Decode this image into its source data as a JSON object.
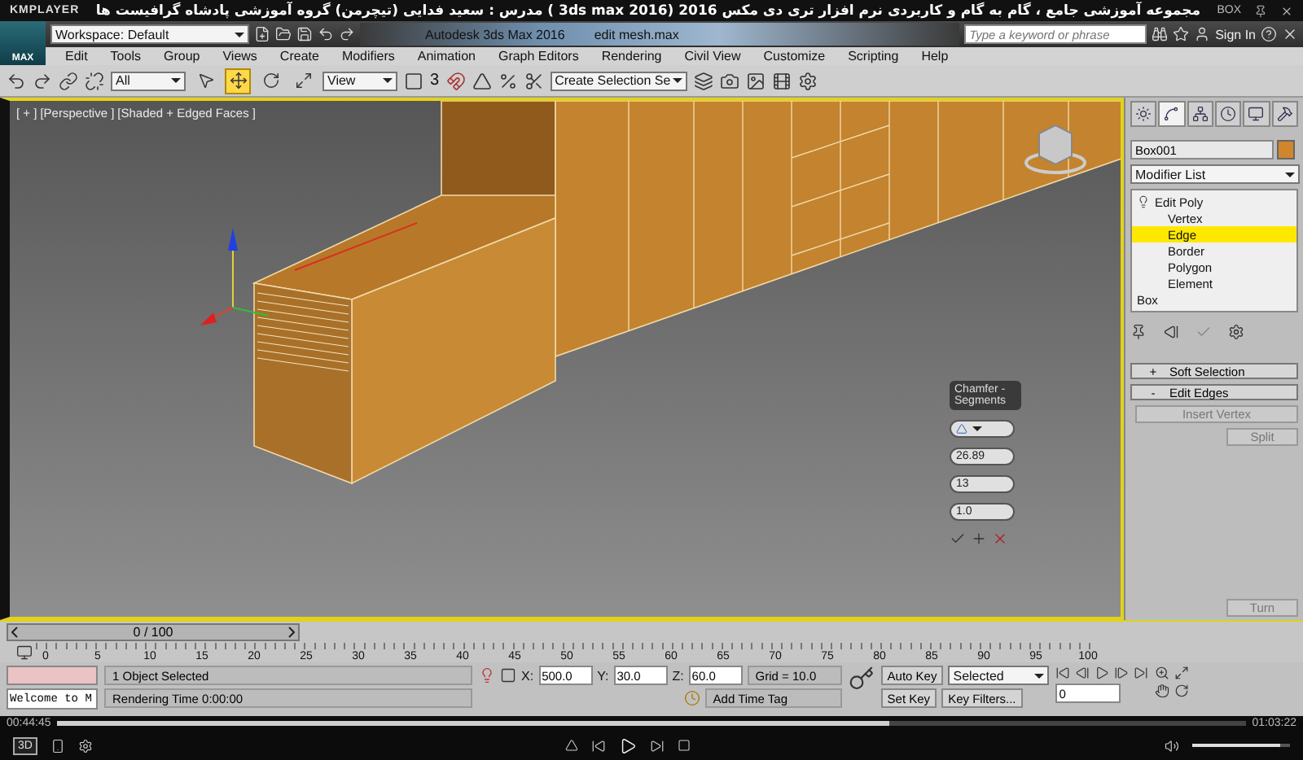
{
  "player": {
    "brand": "KMPLAYER",
    "title": "مجموعه آموزشی جامع ، گام به گام و کاربردی نرم افزار تری دی مکس 2016 (3ds max 2016 )  مدرس : سعید فدایی (تیچرمن) گروه آموزشی پادشاه گرافیست ها",
    "corner": "BOX",
    "elapsed": "00:44:45",
    "total": "01:03:22",
    "progress": {
      "level": 0.7
    },
    "volume": {
      "level": 0.9
    },
    "mode": "3D"
  },
  "app": {
    "logo": "MAX",
    "workspace": "Workspace: Default",
    "title": "Autodesk 3ds Max 2016",
    "file": "edit mesh.max",
    "search": {
      "placeholder": "Type a keyword or phrase"
    },
    "sign_in": "Sign In"
  },
  "menu": [
    "Edit",
    "Tools",
    "Group",
    "Views",
    "Create",
    "Modifiers",
    "Animation",
    "Graph Editors",
    "Rendering",
    "Civil View",
    "Customize",
    "Scripting",
    "Help"
  ],
  "toolbar": {
    "filter": "All",
    "coord": "View",
    "snap": "3",
    "selection_set": "Create Selection Se",
    "tools": [
      {
        "kind": "select",
        "selected": false
      },
      {
        "kind": "move",
        "selected": true
      },
      {
        "kind": "rotate",
        "selected": false
      },
      {
        "kind": "scale",
        "selected": false
      }
    ]
  },
  "viewport": {
    "labels": [
      "[ + ]",
      "[Perspective ]",
      "[Shaded + Edged Faces ]"
    ]
  },
  "caddy": {
    "title": "Chamfer -Segments",
    "fields": [
      "26.89",
      "13",
      "1.0"
    ]
  },
  "command_panel": {
    "tabs": [
      {
        "kind": "create",
        "selected": false
      },
      {
        "kind": "modify",
        "selected": true
      },
      {
        "kind": "hierarchy",
        "selected": false
      },
      {
        "kind": "motion",
        "selected": false
      },
      {
        "kind": "display",
        "selected": false
      },
      {
        "kind": "utilities",
        "selected": false
      }
    ],
    "object_name": "Box001",
    "modifier_list": "Modifier List",
    "stack": [
      {
        "label": "Edit Poly",
        "children": [
          {
            "label": "Vertex",
            "selected": false
          },
          {
            "label": "Edge",
            "selected": true
          },
          {
            "label": "Border",
            "selected": false
          },
          {
            "label": "Polygon",
            "selected": false
          },
          {
            "label": "Element",
            "selected": false
          }
        ]
      },
      {
        "label": "Box"
      }
    ],
    "rollouts": [
      {
        "sign": "+",
        "label": "Soft Selection"
      },
      {
        "sign": "-",
        "label": "Edit Edges"
      }
    ],
    "buttons": [
      "Insert Vertex",
      "Split"
    ],
    "bottom_button": "Turn"
  },
  "time_slider": {
    "label": "0 / 100",
    "level": 0
  },
  "track_ticks": [
    "0",
    "5",
    "10",
    "15",
    "20",
    "25",
    "30",
    "35",
    "40",
    "45",
    "50",
    "55",
    "60",
    "65",
    "70",
    "75",
    "80",
    "85",
    "90",
    "95",
    "100"
  ],
  "status": {
    "prompt": "Welcome to M",
    "selection": "1 Object Selected",
    "render_time": "Rendering Time  0:00:00",
    "coords": [
      {
        "axis": "X:",
        "value": "500.0"
      },
      {
        "axis": "Y:",
        "value": "30.0"
      },
      {
        "axis": "Z:",
        "value": "60.0"
      }
    ],
    "grid": "Grid = 10.0",
    "add_time_tag": "Add Time Tag",
    "auto_key": "Auto Key",
    "key_mode": "Selected",
    "set_key": "Set Key",
    "key_filters": "Key Filters...",
    "frame": "0"
  }
}
